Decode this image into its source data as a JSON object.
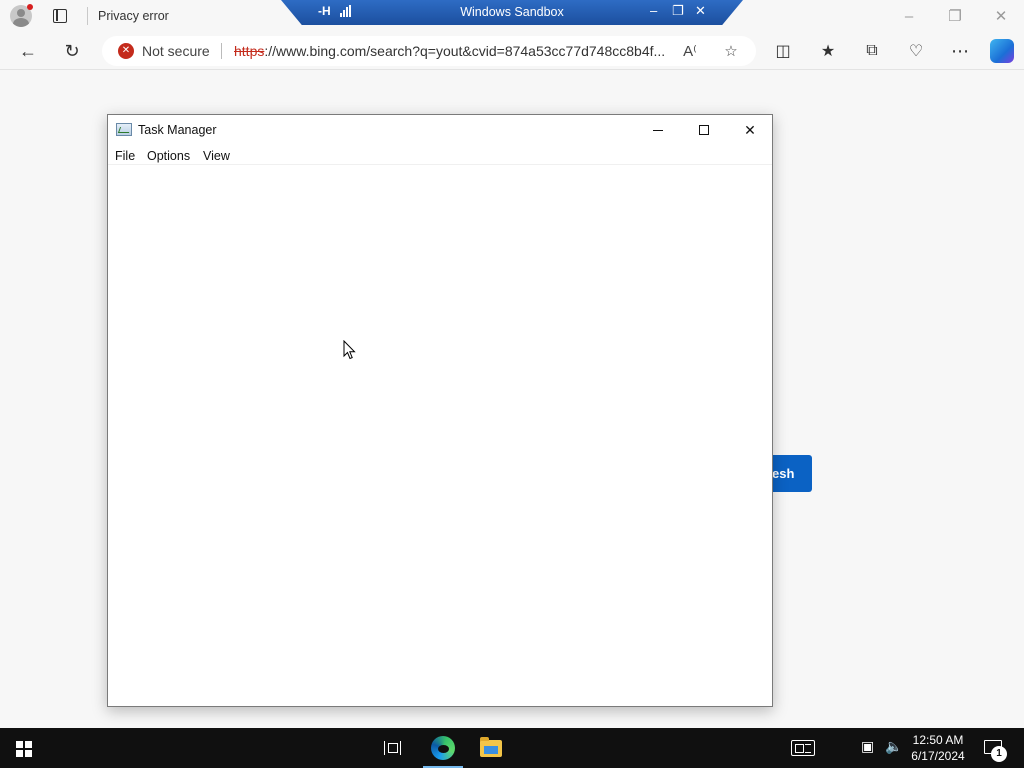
{
  "browser": {
    "tab_title": "Privacy error",
    "security_label": "Not secure",
    "url_scheme": "https",
    "url_rest": "://www.bing.com/search?q=yout&cvid=874a53cc77d748cc8b4f..."
  },
  "sandbox": {
    "title": "Windows Sandbox"
  },
  "page": {
    "refresh_label": "esh"
  },
  "task_manager": {
    "title": "Task Manager",
    "menu": [
      "File",
      "Options",
      "View"
    ]
  },
  "taskbar": {
    "time": "12:50 AM",
    "date": "6/17/2024",
    "notification_count": "1"
  },
  "colors": {
    "accent": "#0b62c4",
    "error": "#c42b1c",
    "taskbar": "#101010",
    "sandbox_banner": "#2e6cc4"
  }
}
